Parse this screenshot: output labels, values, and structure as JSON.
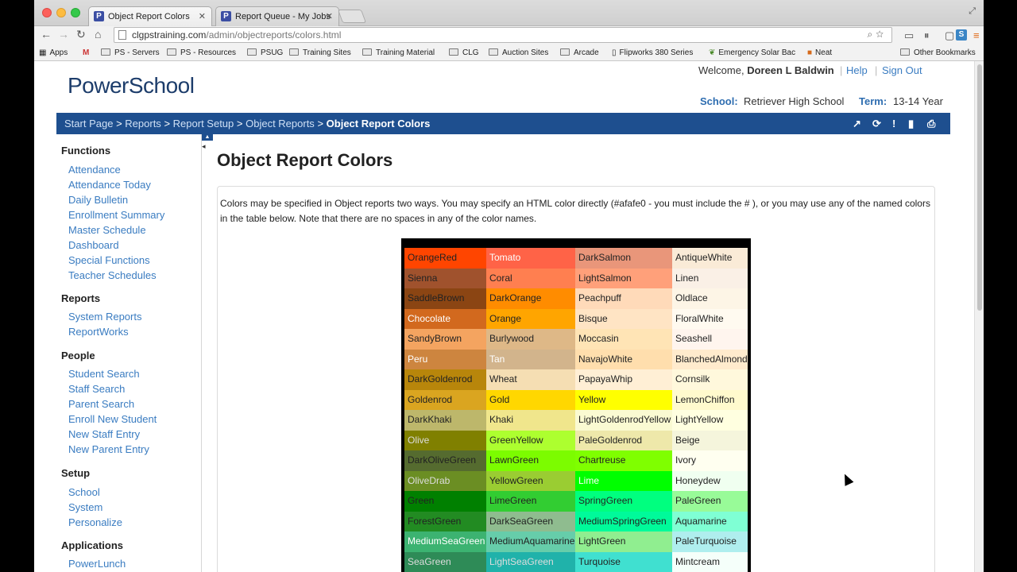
{
  "browser": {
    "tabs": [
      {
        "title": "Object Report Colors",
        "favicon": "P"
      },
      {
        "title": "Report Queue - My Jobs",
        "favicon": "P"
      }
    ],
    "url_host": "clgpstraining.com",
    "url_path": "/admin/objectreports/colors.html",
    "bookmarks": [
      {
        "label": "Apps",
        "icon": "apps-icon"
      },
      {
        "label": "",
        "icon": "gmail-icon"
      },
      {
        "label": "PS - Servers",
        "icon": "folder-icon"
      },
      {
        "label": "PS - Resources",
        "icon": "folder-icon"
      },
      {
        "label": "PSUG",
        "icon": "folder-icon"
      },
      {
        "label": "Training Sites",
        "icon": "folder-icon"
      },
      {
        "label": "Training Material",
        "icon": "folder-icon"
      },
      {
        "label": "CLG",
        "icon": "folder-icon"
      },
      {
        "label": "Auction Sites",
        "icon": "folder-icon"
      },
      {
        "label": "Arcade",
        "icon": "folder-icon"
      },
      {
        "label": "Flipworks 380 Series",
        "icon": "page-icon"
      },
      {
        "label": "Emergency Solar Bac",
        "icon": "leaf-icon"
      },
      {
        "label": "Neat",
        "icon": "neat-icon"
      },
      {
        "label": "Other Bookmarks",
        "icon": "folder-icon"
      }
    ]
  },
  "header": {
    "logo": "PowerSchool",
    "welcome_prefix": "Welcome,",
    "user_name": "Doreen L Baldwin",
    "help": "Help",
    "sign_out": "Sign Out",
    "school_label": "School:",
    "school_value": "Retriever High School",
    "term_label": "Term:",
    "term_value": "13-14 Year"
  },
  "breadcrumb": {
    "items": [
      "Start Page",
      "Reports",
      "Report Setup",
      "Object Reports"
    ],
    "separator": ">",
    "current": "Object Report Colors"
  },
  "sidebar": {
    "sections": [
      {
        "heading": "Functions",
        "links": [
          "Attendance",
          "Attendance Today",
          "Daily Bulletin",
          "Enrollment Summary",
          "Master Schedule",
          "Dashboard",
          "Special Functions",
          "Teacher Schedules"
        ]
      },
      {
        "heading": "Reports",
        "links": [
          "System Reports",
          "ReportWorks"
        ]
      },
      {
        "heading": "People",
        "links": [
          "Student Search",
          "Staff Search",
          "Parent Search",
          "Enroll New Student",
          "New Staff Entry",
          "New Parent Entry"
        ]
      },
      {
        "heading": "Setup",
        "links": [
          "School",
          "System",
          "Personalize"
        ]
      },
      {
        "heading": "Applications",
        "links": [
          "PowerLunch"
        ]
      }
    ]
  },
  "main": {
    "title": "Object Report Colors",
    "intro": "Colors may be specified in Object reports two ways. You may specify an HTML color directly (#afafe0 - you must include the # ), or you may use any of the named colors in the table below. Note that there are no spaces in any of the color names.",
    "color_rows": [
      [
        {
          "name": "OrangeRed",
          "bg": "#ff4500",
          "fg": "#222"
        },
        {
          "name": "Tomato",
          "bg": "#ff6347",
          "fg": "#fff"
        },
        {
          "name": "DarkSalmon",
          "bg": "#e9967a",
          "fg": "#222"
        },
        {
          "name": "AntiqueWhite",
          "bg": "#faebd7",
          "fg": "#222"
        }
      ],
      [
        {
          "name": "Sienna",
          "bg": "#a0522d",
          "fg": "#222"
        },
        {
          "name": "Coral",
          "bg": "#ff7f50",
          "fg": "#222"
        },
        {
          "name": "LightSalmon",
          "bg": "#ffa07a",
          "fg": "#222"
        },
        {
          "name": "Linen",
          "bg": "#faf0e6",
          "fg": "#222"
        }
      ],
      [
        {
          "name": "SaddleBrown",
          "bg": "#8b4513",
          "fg": "#222"
        },
        {
          "name": "DarkOrange",
          "bg": "#ff8c00",
          "fg": "#222"
        },
        {
          "name": "Peachpuff",
          "bg": "#ffdab9",
          "fg": "#222"
        },
        {
          "name": "Oldlace",
          "bg": "#fdf5e6",
          "fg": "#222"
        }
      ],
      [
        {
          "name": "Chocolate",
          "bg": "#d2691e",
          "fg": "#fff"
        },
        {
          "name": "Orange",
          "bg": "#ffa500",
          "fg": "#222"
        },
        {
          "name": "Bisque",
          "bg": "#ffe4c4",
          "fg": "#222"
        },
        {
          "name": "FloralWhite",
          "bg": "#fffaf0",
          "fg": "#222"
        }
      ],
      [
        {
          "name": "SandyBrown",
          "bg": "#f4a460",
          "fg": "#222"
        },
        {
          "name": "Burlywood",
          "bg": "#deb887",
          "fg": "#222"
        },
        {
          "name": "Moccasin",
          "bg": "#ffe4b5",
          "fg": "#222"
        },
        {
          "name": "Seashell",
          "bg": "#fff5ee",
          "fg": "#222"
        }
      ],
      [
        {
          "name": "Peru",
          "bg": "#cd853f",
          "fg": "#fff"
        },
        {
          "name": "Tan",
          "bg": "#d2b48c",
          "fg": "#fff"
        },
        {
          "name": "NavajoWhite",
          "bg": "#ffdead",
          "fg": "#222"
        },
        {
          "name": "BlanchedAlmond",
          "bg": "#ffebcd",
          "fg": "#222"
        }
      ],
      [
        {
          "name": "DarkGoldenrod",
          "bg": "#b8860b",
          "fg": "#222"
        },
        {
          "name": "Wheat",
          "bg": "#f5deb3",
          "fg": "#222"
        },
        {
          "name": "PapayaWhip",
          "bg": "#ffefd5",
          "fg": "#222"
        },
        {
          "name": "Cornsilk",
          "bg": "#fff8dc",
          "fg": "#222"
        }
      ],
      [
        {
          "name": "Goldenrod",
          "bg": "#daa520",
          "fg": "#222"
        },
        {
          "name": "Gold",
          "bg": "#ffd700",
          "fg": "#222"
        },
        {
          "name": "Yellow",
          "bg": "#ffff00",
          "fg": "#222"
        },
        {
          "name": "LemonChiffon",
          "bg": "#fffacd",
          "fg": "#222"
        }
      ],
      [
        {
          "name": "DarkKhaki",
          "bg": "#bdb76b",
          "fg": "#222"
        },
        {
          "name": "Khaki",
          "bg": "#f0e68c",
          "fg": "#222"
        },
        {
          "name": "LightGoldenrodYellow",
          "bg": "#fafad2",
          "fg": "#222"
        },
        {
          "name": "LightYellow",
          "bg": "#ffffe0",
          "fg": "#222"
        }
      ],
      [
        {
          "name": "Olive",
          "bg": "#808000",
          "fg": "#ddd"
        },
        {
          "name": "GreenYellow",
          "bg": "#adff2f",
          "fg": "#222"
        },
        {
          "name": "PaleGoldenrod",
          "bg": "#eee8aa",
          "fg": "#222"
        },
        {
          "name": "Beige",
          "bg": "#f5f5dc",
          "fg": "#222"
        }
      ],
      [
        {
          "name": "DarkOliveGreen",
          "bg": "#556b2f",
          "fg": "#222"
        },
        {
          "name": "LawnGreen",
          "bg": "#7cfc00",
          "fg": "#222"
        },
        {
          "name": "Chartreuse",
          "bg": "#7fff00",
          "fg": "#222"
        },
        {
          "name": "Ivory",
          "bg": "#fffff0",
          "fg": "#222"
        }
      ],
      [
        {
          "name": "OliveDrab",
          "bg": "#6b8e23",
          "fg": "#ddd"
        },
        {
          "name": "YellowGreen",
          "bg": "#9acd32",
          "fg": "#222"
        },
        {
          "name": "Lime",
          "bg": "#00ff00",
          "fg": "#fff"
        },
        {
          "name": "Honeydew",
          "bg": "#f0fff0",
          "fg": "#222"
        }
      ],
      [
        {
          "name": "Green",
          "bg": "#008000",
          "fg": "#222"
        },
        {
          "name": "LimeGreen",
          "bg": "#32cd32",
          "fg": "#222"
        },
        {
          "name": "SpringGreen",
          "bg": "#00ff7f",
          "fg": "#222"
        },
        {
          "name": "PaleGreen",
          "bg": "#98fb98",
          "fg": "#222"
        }
      ],
      [
        {
          "name": "ForestGreen",
          "bg": "#228b22",
          "fg": "#222"
        },
        {
          "name": "DarkSeaGreen",
          "bg": "#8fbc8f",
          "fg": "#222"
        },
        {
          "name": "MediumSpringGreen",
          "bg": "#00fa9a",
          "fg": "#222"
        },
        {
          "name": "Aquamarine",
          "bg": "#7fffd4",
          "fg": "#222"
        }
      ],
      [
        {
          "name": "MediumSeaGreen",
          "bg": "#3cb371",
          "fg": "#fff"
        },
        {
          "name": "MediumAquamarine",
          "bg": "#66cdaa",
          "fg": "#222"
        },
        {
          "name": "LightGreen",
          "bg": "#90ee90",
          "fg": "#222"
        },
        {
          "name": "PaleTurquoise",
          "bg": "#afeeee",
          "fg": "#222"
        }
      ],
      [
        {
          "name": "SeaGreen",
          "bg": "#2e8b57",
          "fg": "#ddd"
        },
        {
          "name": "LightSeaGreen",
          "bg": "#20b2aa",
          "fg": "#ddd"
        },
        {
          "name": "Turquoise",
          "bg": "#40e0d0",
          "fg": "#222"
        },
        {
          "name": "Mintcream",
          "bg": "#f5fffa",
          "fg": "#222"
        }
      ]
    ]
  },
  "colors": {
    "brand_blue": "#1e4f8f",
    "link": "#3a7cc1"
  }
}
